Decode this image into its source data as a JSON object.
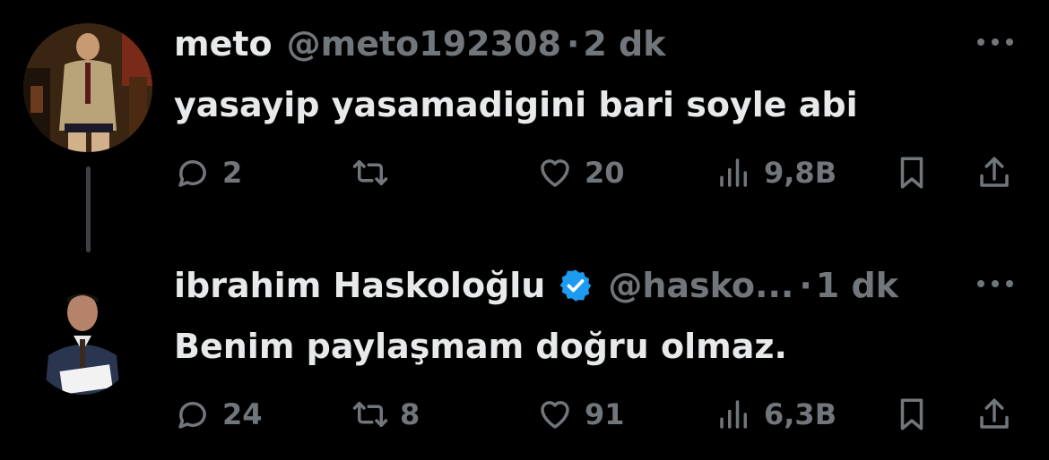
{
  "tweets": [
    {
      "name": "meto",
      "handle": "@meto192308",
      "separator": "·",
      "time": "2 dk",
      "text": "yasayip yasamadigini bari soyle abi",
      "verified": false,
      "replies": "2",
      "retweets": "",
      "likes": "20",
      "views": "9,8B"
    },
    {
      "name": "ibrahim Haskoloğlu",
      "handle": "@hasko...",
      "separator": "·",
      "time": "1 dk",
      "text": "Benim paylaşmam doğru olmaz.",
      "verified": true,
      "replies": "24",
      "retweets": "8",
      "likes": "91",
      "views": "6,3B"
    }
  ],
  "colors": {
    "background": "#000000",
    "primary_text": "#e7e9ea",
    "secondary_text": "#71767b",
    "verified_badge": "#1d9bf0",
    "thread_line": "#3e4144"
  }
}
